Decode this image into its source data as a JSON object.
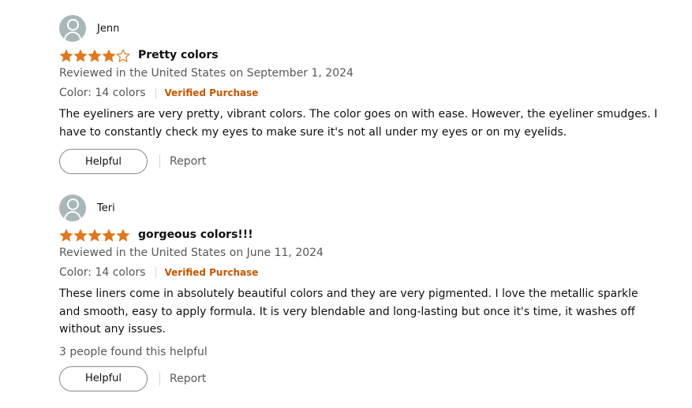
{
  "colors": {
    "star": "#de7921",
    "verified": "#c45500",
    "avatar_bg": "#aab7b8",
    "text": "#0f1111",
    "secondary_text": "#565959"
  },
  "reviews": [
    {
      "reviewer": "Jenn",
      "rating": 4,
      "rating_max": 5,
      "title": "Pretty colors",
      "date": "Reviewed in the United States on September 1, 2024",
      "variant": "Color: 14 colors",
      "verified": "Verified Purchase",
      "body": "The eyeliners are very pretty, vibrant colors. The color goes on with ease. However, the eyeliner smudges. I have to constantly check my eyes to make sure it's not all under my eyes or on my eyelids.",
      "helpful_count": "",
      "helpful_label": "Helpful",
      "report_label": "Report"
    },
    {
      "reviewer": "Teri",
      "rating": 5,
      "rating_max": 5,
      "title": "gorgeous colors!!!",
      "date": "Reviewed in the United States on June 11, 2024",
      "variant": "Color: 14 colors",
      "verified": "Verified Purchase",
      "body": "These liners come in absolutely beautiful colors and they are very pigmented. I love the metallic sparkle and smooth, easy to apply formula. It is very blendable and long-lasting but once it's time, it washes off without any issues.",
      "helpful_count": "3 people found this helpful",
      "helpful_label": "Helpful",
      "report_label": "Report"
    }
  ]
}
